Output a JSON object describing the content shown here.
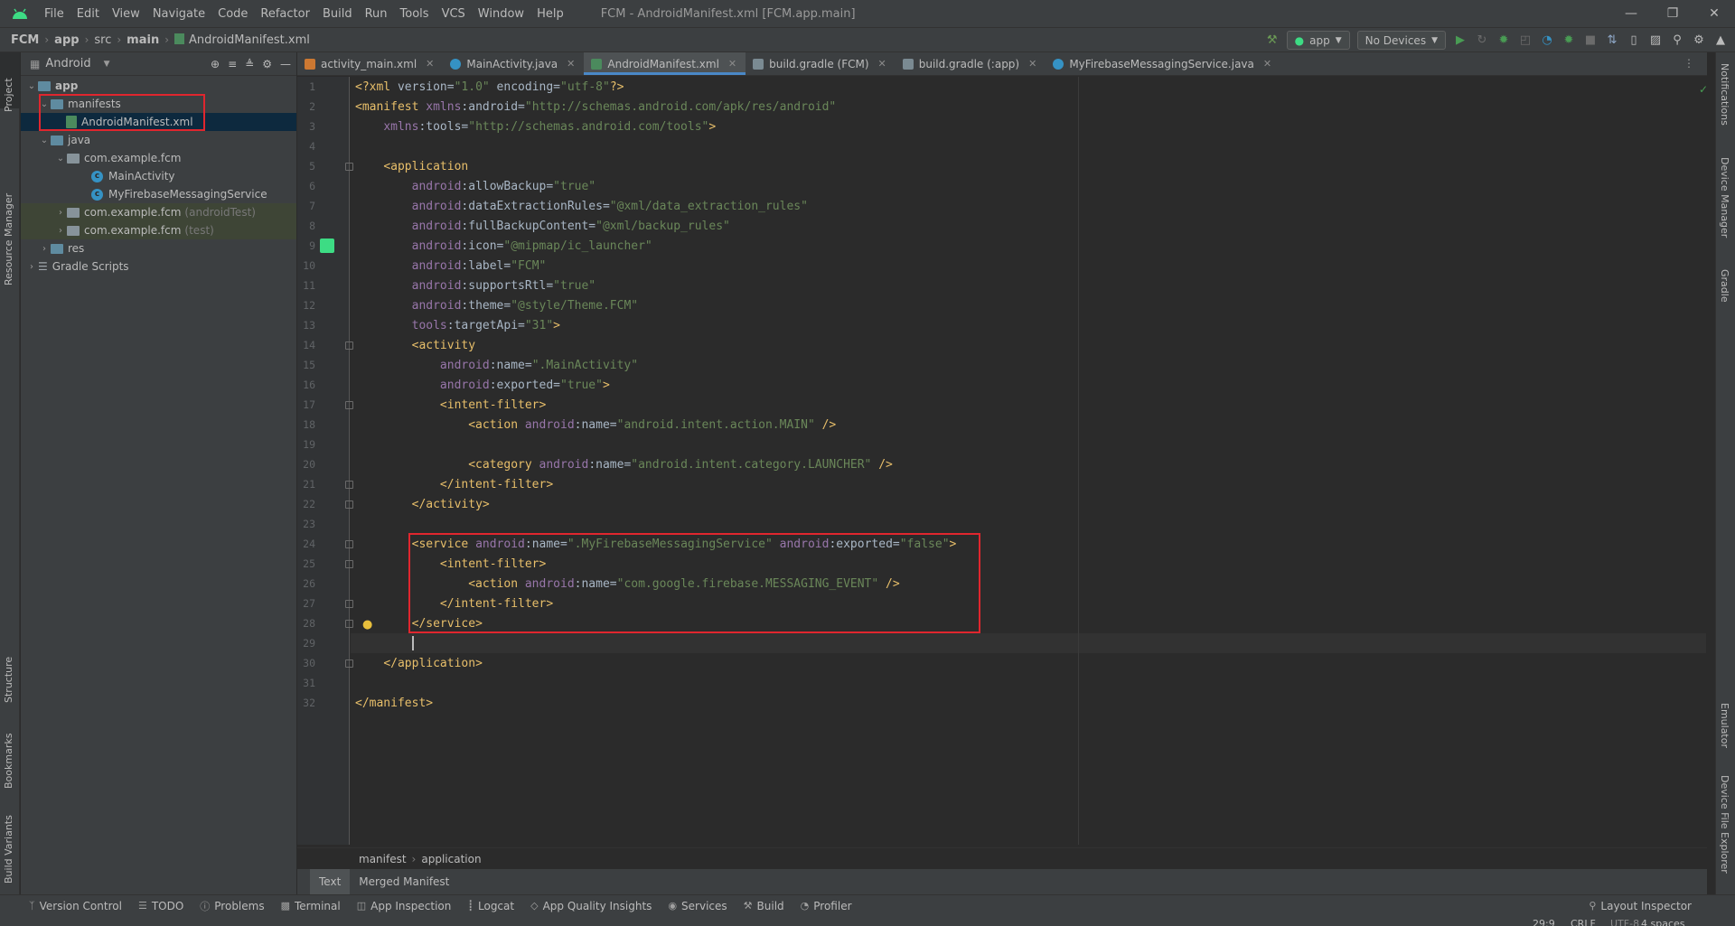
{
  "window": {
    "menu": [
      "File",
      "Edit",
      "View",
      "Navigate",
      "Code",
      "Refactor",
      "Build",
      "Run",
      "Tools",
      "VCS",
      "Window",
      "Help"
    ],
    "title": "FCM - AndroidManifest.xml [FCM.app.main]"
  },
  "navbar": {
    "crumbs": [
      "FCM",
      "app",
      "src",
      "main",
      "AndroidManifest.xml"
    ],
    "run_config": "app",
    "device": "No Devices"
  },
  "project": {
    "view": "Android",
    "tree": [
      {
        "label": "app",
        "extra": ""
      },
      {
        "label": "manifests",
        "extra": ""
      },
      {
        "label": "AndroidManifest.xml",
        "extra": ""
      },
      {
        "label": "java",
        "extra": ""
      },
      {
        "label": "com.example.fcm",
        "extra": ""
      },
      {
        "label": "MainActivity",
        "extra": ""
      },
      {
        "label": "MyFirebaseMessagingService",
        "extra": ""
      },
      {
        "label": "com.example.fcm",
        "extra": "(androidTest)"
      },
      {
        "label": "com.example.fcm",
        "extra": "(test)"
      },
      {
        "label": "res",
        "extra": ""
      },
      {
        "label": "Gradle Scripts",
        "extra": ""
      }
    ]
  },
  "left_strip": [
    "Project",
    "Resource Manager",
    "Structure",
    "Bookmarks",
    "Build Variants"
  ],
  "right_strip": [
    "Notifications",
    "Device Manager",
    "Gradle",
    "Emulator",
    "Device File Explorer"
  ],
  "tabs": [
    "activity_main.xml",
    "MainActivity.java",
    "AndroidManifest.xml",
    "build.gradle (FCM)",
    "build.gradle (:app)",
    "MyFirebaseMessagingService.java"
  ],
  "active_tab": "AndroidManifest.xml",
  "editor": {
    "lines": [
      "<?xml version=\"1.0\" encoding=\"utf-8\"?>",
      "<manifest xmlns:android=\"http://schemas.android.com/apk/res/android\"",
      "    xmlns:tools=\"http://schemas.android.com/tools\">",
      "",
      "    <application",
      "        android:allowBackup=\"true\"",
      "        android:dataExtractionRules=\"@xml/data_extraction_rules\"",
      "        android:fullBackupContent=\"@xml/backup_rules\"",
      "        android:icon=\"@mipmap/ic_launcher\"",
      "        android:label=\"FCM\"",
      "        android:supportsRtl=\"true\"",
      "        android:theme=\"@style/Theme.FCM\"",
      "        tools:targetApi=\"31\">",
      "        <activity",
      "            android:name=\".MainActivity\"",
      "            android:exported=\"true\">",
      "            <intent-filter>",
      "                <action android:name=\"android.intent.action.MAIN\" />",
      "",
      "                <category android:name=\"android.intent.category.LAUNCHER\" />",
      "            </intent-filter>",
      "        </activity>",
      "",
      "        <service android:name=\".MyFirebaseMessagingService\" android:exported=\"false\">",
      "            <intent-filter>",
      "                <action android:name=\"com.google.firebase.MESSAGING_EVENT\" />",
      "            </intent-filter>",
      "        </service>",
      "",
      "    </application>",
      "",
      "</manifest>"
    ],
    "breadcrumb": [
      "manifest",
      "application"
    ],
    "view_tabs": [
      "Text",
      "Merged Manifest"
    ]
  },
  "tool_windows": [
    "Version Control",
    "TODO",
    "Problems",
    "Terminal",
    "App Inspection",
    "Logcat",
    "App Quality Insights",
    "Services",
    "Build",
    "Profiler"
  ],
  "layout_inspector": "Layout Inspector",
  "status": {
    "position": "29:9",
    "line_sep": "CRLF",
    "encoding": "UTF-8",
    "indent": "4 spaces"
  }
}
